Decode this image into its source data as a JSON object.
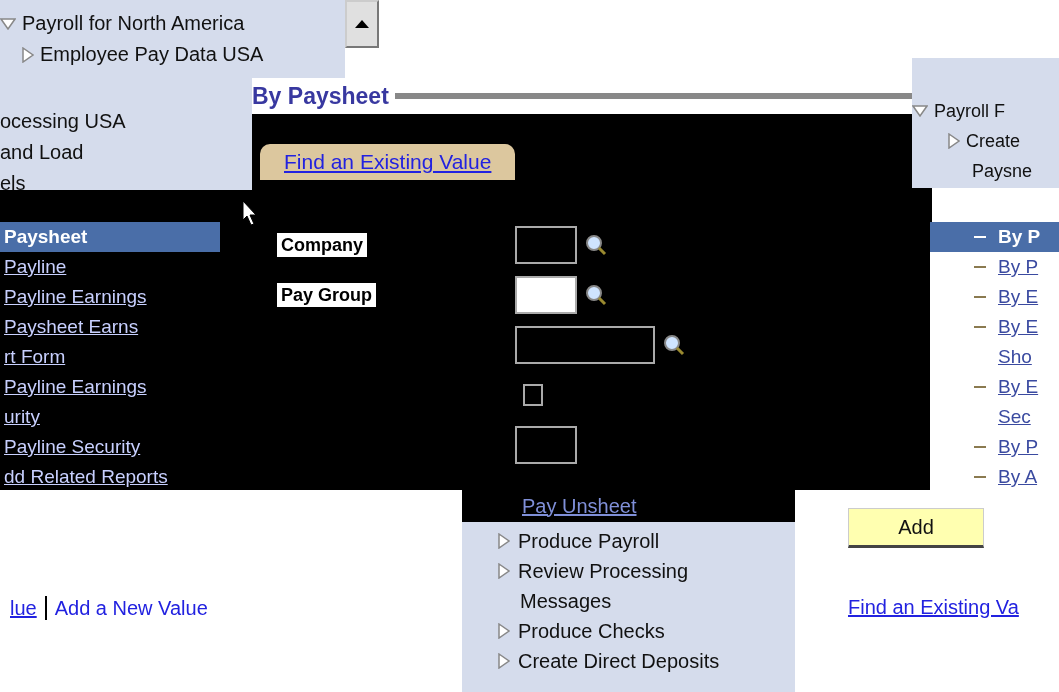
{
  "top_left_tree": {
    "items": [
      {
        "label": "Payroll for North America",
        "expanded": true,
        "children": [
          {
            "label": "Employee Pay Data USA",
            "expanded": false
          }
        ]
      },
      {
        "label": "ocessing USA",
        "kind": "text"
      },
      {
        "label": "and Load",
        "kind": "text"
      },
      {
        "label": "els",
        "kind": "text"
      }
    ]
  },
  "page": {
    "title": "By Paysheet",
    "tabs": [
      {
        "label": "Find an Existing Value",
        "selected": true
      }
    ],
    "fields": [
      {
        "kind": "prompt",
        "label": "Company",
        "filled": true,
        "wide": false
      },
      {
        "kind": "prompt",
        "label": "Pay Group",
        "filled": false,
        "wide": false
      },
      {
        "kind": "prompt",
        "filled": true,
        "wide": true
      },
      {
        "kind": "checkbox",
        "checked": false
      },
      {
        "kind": "text",
        "filled": true,
        "wide": false
      }
    ],
    "add_button": "Add",
    "bottom_links": [
      {
        "label": "lue",
        "underlined": true
      },
      {
        "label": "Add a New Value",
        "underlined": false
      }
    ],
    "right_link": "Find an Existing Va"
  },
  "left_menu": {
    "items": [
      {
        "label": "Paysheet",
        "selected": true
      },
      {
        "label": "Payline",
        "selected": false
      },
      {
        "label": "Payline Earnings",
        "selected": false
      },
      {
        "label": "Paysheet Earns",
        "selected": false
      },
      {
        "label": "rt Form",
        "selected": false
      },
      {
        "label": "Payline Earnings",
        "selected": false
      },
      {
        "label": "urity",
        "selected": false
      },
      {
        "label": "Payline Security",
        "selected": false
      },
      {
        "label": "dd Related Reports",
        "selected": false
      }
    ]
  },
  "right_tree": {
    "items": [
      {
        "label": "Payroll F",
        "expanded": true,
        "children": [
          {
            "label": "Create",
            "expanded": false
          }
        ]
      },
      {
        "label": "Paysne",
        "kind": "text"
      }
    ]
  },
  "right_menu": {
    "items": [
      {
        "label": "By P",
        "kind": "item",
        "selected": true
      },
      {
        "label": "By P",
        "kind": "item",
        "selected": false
      },
      {
        "label": "By E",
        "kind": "item",
        "selected": false
      },
      {
        "label": "By E",
        "kind": "item",
        "selected": false
      },
      {
        "label": "Sho",
        "kind": "wrap",
        "selected": false
      },
      {
        "label": "By E",
        "kind": "item",
        "selected": false
      },
      {
        "label": "Sec",
        "kind": "wrap",
        "selected": false
      },
      {
        "label": "By P",
        "kind": "item",
        "selected": false
      },
      {
        "label": "By A",
        "kind": "item",
        "selected": false
      }
    ]
  },
  "bottom_menu": {
    "items": [
      {
        "label": "Pay Unsheet",
        "kind": "link"
      },
      {
        "label": "Produce Payroll",
        "kind": "folder"
      },
      {
        "label": "Review Processing",
        "kind": "folder"
      },
      {
        "label": "Messages",
        "kind": "wrap"
      },
      {
        "label": "Produce Checks",
        "kind": "folder"
      },
      {
        "label": "Create Direct Deposits",
        "kind": "folder"
      }
    ]
  }
}
